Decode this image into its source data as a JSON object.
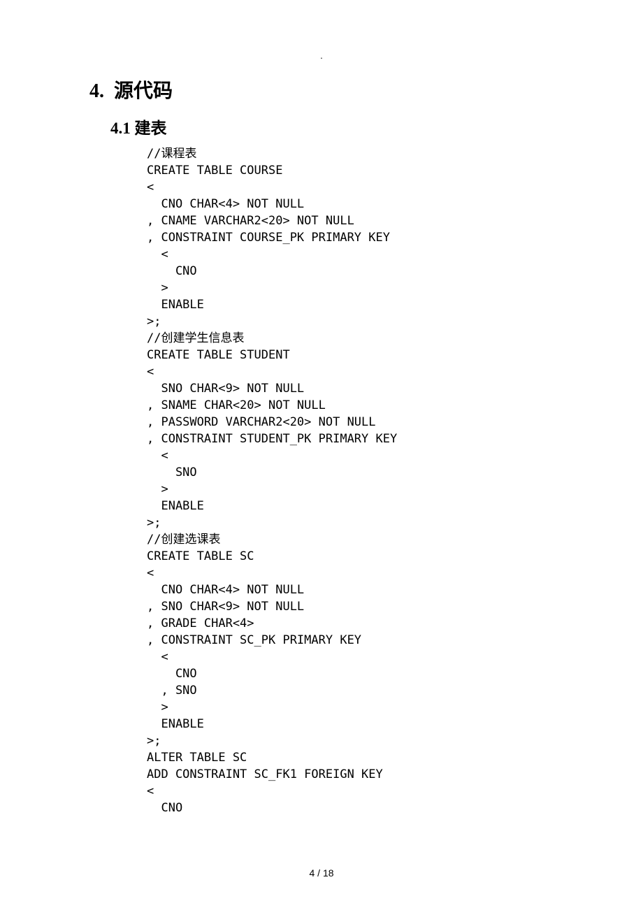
{
  "header_mark": ".",
  "h1": {
    "num": "4.",
    "text": "源代码"
  },
  "h2": {
    "num": "4.1",
    "text": "建表"
  },
  "code": [
    "//课程表",
    "CREATE TABLE COURSE ",
    "<",
    "  CNO CHAR<4> NOT NULL ",
    ", CNAME VARCHAR2<20> NOT NULL ",
    ", CONSTRAINT COURSE_PK PRIMARY KEY ",
    "  <",
    "    CNO ",
    "  >",
    "  ENABLE ",
    ">;",
    "//创建学生信息表",
    "CREATE TABLE STUDENT ",
    "<",
    "  SNO CHAR<9> NOT NULL ",
    ", SNAME CHAR<20> NOT NULL ",
    ", PASSWORD VARCHAR2<20> NOT NULL ",
    ", CONSTRAINT STUDENT_PK PRIMARY KEY ",
    "  <",
    "    SNO ",
    "  >",
    "  ENABLE ",
    ">;",
    "//创建选课表",
    "CREATE TABLE SC ",
    "<",
    "  CNO CHAR<4> NOT NULL ",
    ", SNO CHAR<9> NOT NULL ",
    ", GRADE CHAR<4> ",
    ", CONSTRAINT SC_PK PRIMARY KEY ",
    "  <",
    "    CNO ",
    "  , SNO ",
    "  >",
    "  ENABLE ",
    ">;",
    "ALTER TABLE SC",
    "ADD CONSTRAINT SC_FK1 FOREIGN KEY",
    "<",
    "  CNO"
  ],
  "footer": "4 / 18"
}
